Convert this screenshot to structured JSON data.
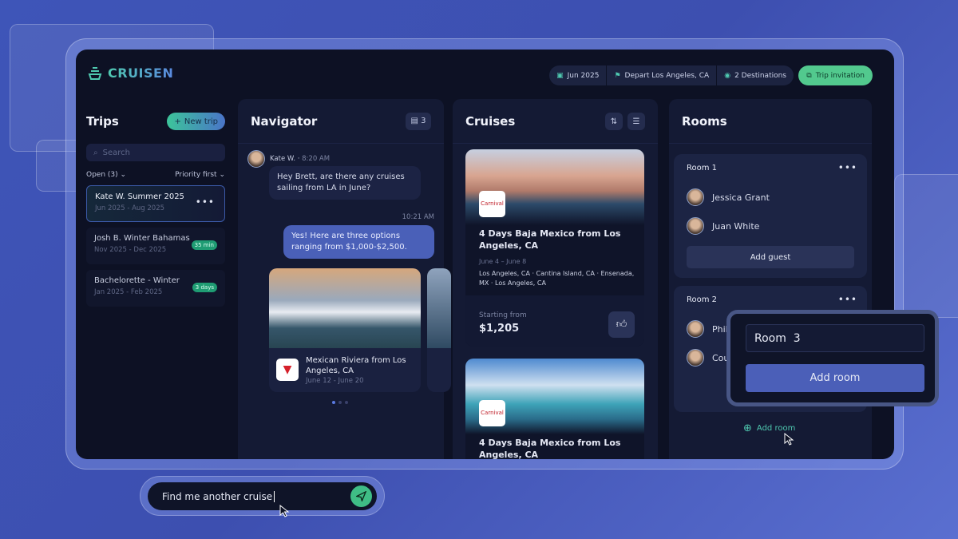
{
  "brand": {
    "name": "CRUISEN",
    "accent": "#4fc9b0"
  },
  "header": {
    "chips": [
      {
        "icon": "calendar-icon",
        "label": "Jun 2025"
      },
      {
        "icon": "flag-icon",
        "label": "Depart Los Angeles, CA"
      },
      {
        "icon": "pin-icon",
        "label": "2 Destinations"
      }
    ],
    "invite_label": "Trip invitation"
  },
  "trips": {
    "title": "Trips",
    "new_label": "New trip",
    "search_placeholder": "Search",
    "filter_open": "Open (3)",
    "filter_sort": "Priority first",
    "items": [
      {
        "title": "Kate W. Summer 2025",
        "dates": "Jun 2025 - Aug 2025",
        "badge": ""
      },
      {
        "title": "Josh B. Winter Bahamas",
        "dates": "Nov 2025 - Dec 2025",
        "badge": "35 min"
      },
      {
        "title": "Bachelorette - Winter",
        "dates": "Jan 2025 - Feb 2025",
        "badge": "3 days"
      }
    ]
  },
  "navigator": {
    "title": "Navigator",
    "doc_count": "3",
    "messages": [
      {
        "sender": "Kate W.",
        "time": "8:20 AM",
        "text": "Hey Brett, are there any cruises sailing from LA in June?"
      },
      {
        "time": "10:21 AM",
        "text": "Yes! Here are three options ranging from $1,000-$2,500."
      }
    ],
    "card": {
      "title": "Mexican Riviera from Los Angeles, CA",
      "dates": "June 12 - June 20"
    }
  },
  "cruises": {
    "title": "Cruises",
    "items": [
      {
        "title": "4 Days Baja Mexico from Los Angeles, CA",
        "dates": "June 4 – June 8",
        "route": "Los Angeles, CA · Cantina Island, CA · Ensenada, MX · Los Angeles, CA",
        "price_label": "Starting from",
        "price": "$1,205"
      },
      {
        "title": "4 Days Baja Mexico from Los Angeles, CA"
      }
    ]
  },
  "rooms": {
    "title": "Rooms",
    "items": [
      {
        "name": "Room 1",
        "guests": [
          "Jessica Grant",
          "Juan White"
        ],
        "add_label": "Add guest"
      },
      {
        "name": "Room 2",
        "guests": [
          "Phillip",
          "Court"
        ]
      }
    ],
    "add_room_label": "Add room"
  },
  "popup": {
    "input_value": "Room  3",
    "button_label": "Add room"
  },
  "prompt": {
    "value": "Find me another cruise"
  }
}
